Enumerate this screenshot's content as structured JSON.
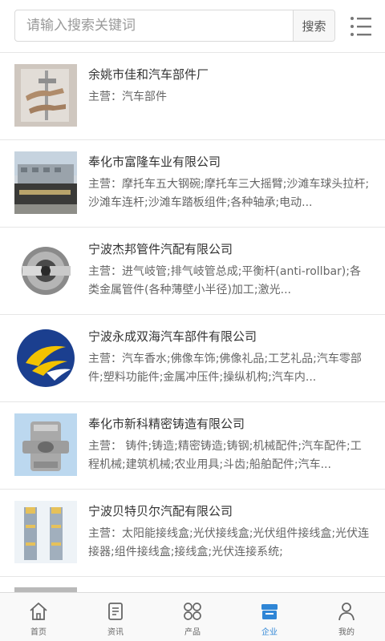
{
  "search": {
    "placeholder": "请输入搜索关键词",
    "button_label": "搜索"
  },
  "companies": [
    {
      "name": "余姚市佳和汽车部件厂",
      "desc": "主营：汽车部件"
    },
    {
      "name": "奉化市富隆车业有限公司",
      "desc": "主营：摩托车五大钢碗;摩托车三大摇臂;沙滩车球头拉杆;沙滩车连杆;沙滩车踏板组件;各种轴承;电动..."
    },
    {
      "name": "宁波杰邦管件汽配有限公司",
      "desc": "主营：进气岐管;排气岐管总成;平衡杆(anti-rollbar);各类金属管件(各种薄壁小半径)加工;激光..."
    },
    {
      "name": "宁波永成双海汽车部件有限公司",
      "desc": "主营：汽车香水;佛像车饰;佛像礼品;工艺礼品;汽车零部件;塑料功能件;金属冲压件;操纵机构;汽车内..."
    },
    {
      "name": "奉化市新科精密铸造有限公司",
      "desc": "主营： 铸件;铸造;精密铸造;铸钢;机械配件;汽车配件;工程机械;建筑机械;农业用具;斗齿;船舶配件;汽车..."
    },
    {
      "name": "宁波贝特贝尔汽配有限公司",
      "desc": "主营：太阳能接线盒;光伏接线盒;光伏组件接线盒;光伏连接器;组件接线盒;接线盒;光伏连接系统;"
    }
  ],
  "tabs": [
    {
      "label": "首页",
      "icon": "home-icon"
    },
    {
      "label": "资讯",
      "icon": "news-icon"
    },
    {
      "label": "产品",
      "icon": "grid-icon"
    },
    {
      "label": "企业",
      "icon": "store-icon",
      "active": true
    },
    {
      "label": "我的",
      "icon": "user-icon"
    }
  ],
  "colors": {
    "accent": "#2f86d6",
    "border": "#e6e6e6",
    "text": "#333333",
    "muted": "#666666"
  }
}
